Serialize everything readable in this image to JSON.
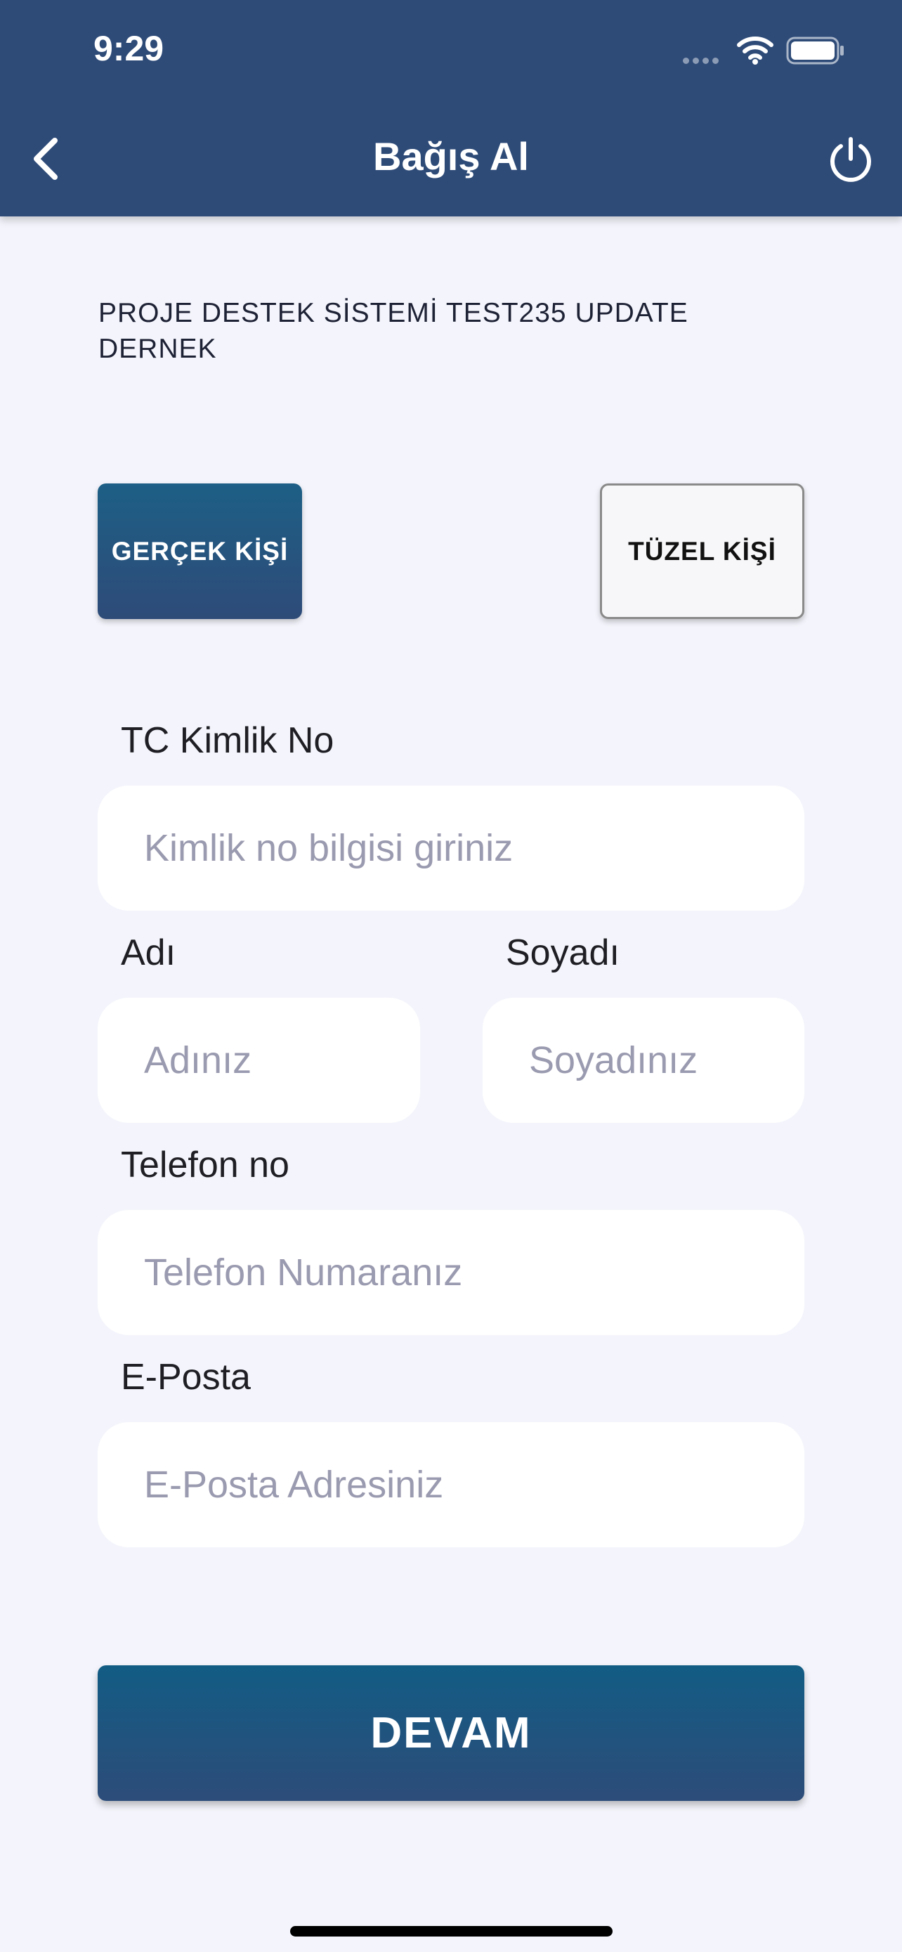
{
  "status_bar": {
    "time": "9:29"
  },
  "nav": {
    "title": "Bağış Al"
  },
  "org": {
    "name": "PROJE DESTEK SİSTEMİ TEST235 UPDATE DERNEK"
  },
  "person_type": {
    "real_label": "GERÇEK KİŞİ",
    "legal_label": "TÜZEL KİŞİ",
    "selected": "GERÇEK KİŞİ"
  },
  "form": {
    "tc": {
      "label": "TC Kimlik No",
      "placeholder": "Kimlik no bilgisi giriniz",
      "value": ""
    },
    "first_name": {
      "label": "Adı",
      "placeholder": "Adınız",
      "value": ""
    },
    "last_name": {
      "label": "Soyadı",
      "placeholder": "Soyadınız",
      "value": ""
    },
    "phone": {
      "label": "Telefon no",
      "placeholder": "Telefon Numaranız",
      "value": ""
    },
    "email": {
      "label": "E-Posta",
      "placeholder": "E-Posta Adresiniz",
      "value": ""
    }
  },
  "actions": {
    "continue_label": "DEVAM"
  },
  "colors": {
    "header": "#2E4B78",
    "background": "#F4F5FC",
    "button": "#1D5F86"
  }
}
